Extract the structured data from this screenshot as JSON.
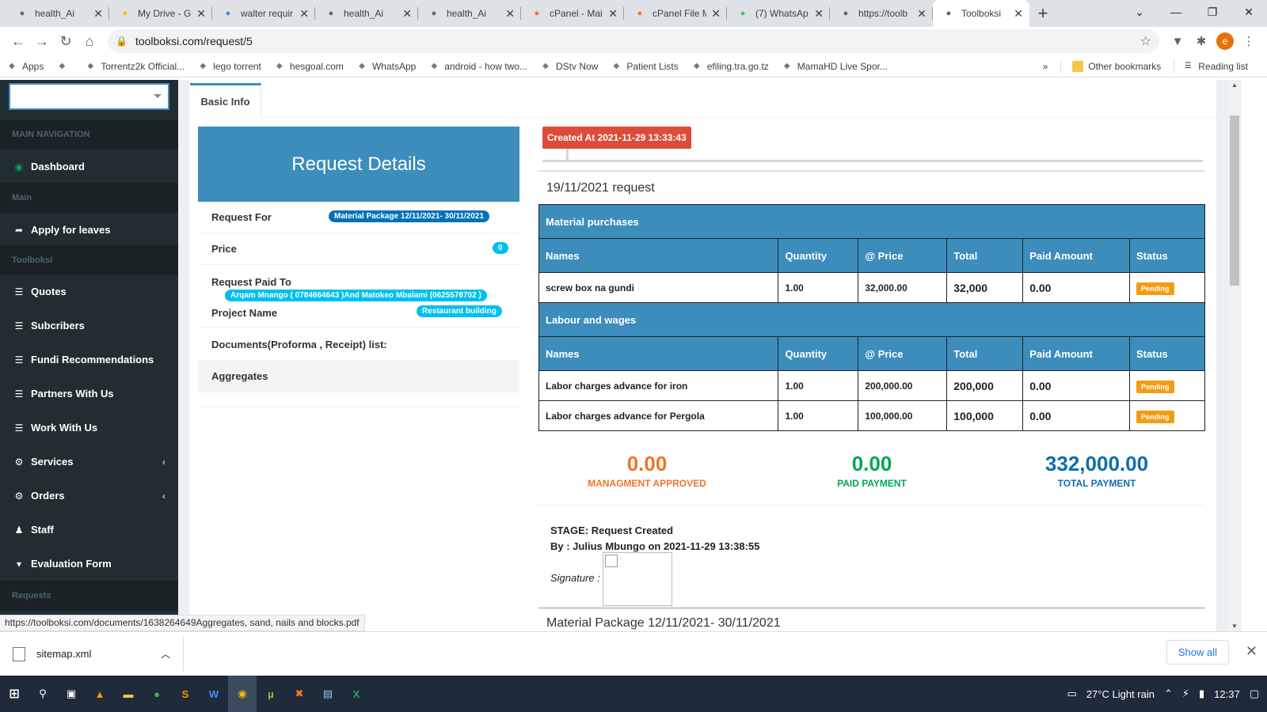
{
  "browser": {
    "tabs": [
      {
        "title": "health_Ai",
        "icon": "shield-icon",
        "color": "#5f6368"
      },
      {
        "title": "My Drive - G",
        "icon": "drive-icon",
        "color": "#fbbc04"
      },
      {
        "title": "walter requir",
        "icon": "docs-icon",
        "color": "#4285f4"
      },
      {
        "title": "health_Ai",
        "icon": "shield-icon",
        "color": "#5f6368"
      },
      {
        "title": "health_Ai",
        "icon": "shield-icon",
        "color": "#5f6368"
      },
      {
        "title": "cPanel - Mai",
        "icon": "cpanel-icon",
        "color": "#ff6c2c"
      },
      {
        "title": "cPanel File M",
        "icon": "cpanel-icon",
        "color": "#ff6c2c"
      },
      {
        "title": "(7) WhatsAp",
        "icon": "whatsapp-icon",
        "color": "#25d366"
      },
      {
        "title": "https://toolb",
        "icon": "globe-icon",
        "color": "#5f6368"
      },
      {
        "title": "Toolboksi",
        "icon": "globe-icon",
        "color": "#5f6368"
      }
    ],
    "url": "toolboksi.com/request/5",
    "bookmarks": [
      {
        "label": "Apps",
        "icon": "apps-icon"
      },
      {
        "label": "",
        "icon": "bookmark-icon"
      },
      {
        "label": "Torrentz2k Official...",
        "icon": "torrent-icon"
      },
      {
        "label": "lego torrent",
        "icon": "lego-icon"
      },
      {
        "label": "hesgoal.com",
        "icon": "hesgoal-icon"
      },
      {
        "label": "WhatsApp",
        "icon": "whatsapp-icon"
      },
      {
        "label": "android - how two...",
        "icon": "stack-icon"
      },
      {
        "label": "DStv Now",
        "icon": "play-icon"
      },
      {
        "label": "Patient Lists",
        "icon": "shield-icon"
      },
      {
        "label": "efiling.tra.go.tz",
        "icon": "tra-icon"
      },
      {
        "label": "MamaHD Live Spor...",
        "icon": "sports-icon"
      }
    ],
    "bookmarks_more": "»",
    "other_bookmarks": "Other bookmarks",
    "reading_list": "Reading list",
    "avatar_letter": "e",
    "status_url": "https://toolboksi.com/documents/1638264649Aggregates, sand, nails and blocks.pdf"
  },
  "sidebar": {
    "sections": {
      "main_navigation": "MAIN NAVIGATION",
      "main": "Main",
      "toolboksi": "Toolboksi",
      "requests": "Requests"
    },
    "items": {
      "dashboard": "Dashboard",
      "apply_leaves": "Apply for leaves",
      "quotes": "Quotes",
      "subscribers": "Subcribers",
      "fundi": "Fundi Recommendations",
      "partners": "Partners With Us",
      "work": "Work With Us",
      "services": "Services",
      "orders": "Orders",
      "staff": "Staff",
      "evaluation": "Evaluation Form"
    }
  },
  "tab_label": "Basic Info",
  "details": {
    "title": "Request Details",
    "request_for_label": "Request For",
    "request_for_value": "Material Package 12/11/2021- 30/11/2021",
    "price_label": "Price",
    "price_value": "0",
    "paid_to_label": "Request Paid To",
    "paid_to_value": "Arqam Mnango ( 0784664643 )And Matokeo Mbalami (0625578702 )",
    "project_label": "Project Name",
    "project_value": "Restaurant building",
    "documents_label": "Documents(Proforma , Receipt) list:",
    "aggregates_label": "Aggregates"
  },
  "timeline": {
    "created": "Created At 2021-11-29 13:33:43",
    "request_title": "19/11/2021 request",
    "material_section": "Material purchases",
    "labour_section": "Labour and wages",
    "columns": [
      "Names",
      "Quantity",
      "@ Price",
      "Total",
      "Paid Amount",
      "Status"
    ],
    "material_rows": [
      {
        "name": "screw box na gundi",
        "qty": "1.00",
        "price": "32,000.00",
        "total": "32,000",
        "paid": "0.00",
        "status": "Pending"
      }
    ],
    "labour_rows": [
      {
        "name": "Labor charges advance for iron",
        "qty": "1.00",
        "price": "200,000.00",
        "total": "200,000",
        "paid": "0.00",
        "status": "Pending"
      },
      {
        "name": "Labor charges advance for Pergola",
        "qty": "1.00",
        "price": "100,000.00",
        "total": "100,000",
        "paid": "0.00",
        "status": "Pending"
      }
    ],
    "stats": [
      {
        "value": "0.00",
        "label": "MANAGMENT APPROVED",
        "color": "#f0742c"
      },
      {
        "value": "0.00",
        "label": "PAID PAYMENT",
        "color": "#00a65a"
      },
      {
        "value": "332,000.00",
        "label": "TOTAL PAYMENT",
        "color": "#0f6fa8"
      }
    ],
    "stage": "STAGE: Request Created",
    "stage_by": "By : Julius Mbungo on 2021-11-29 13:38:55",
    "signature_label": "Signature :",
    "package_title": "Material Package 12/11/2021- 30/11/2021"
  },
  "downloads": {
    "file": "sitemap.xml",
    "show_all": "Show all"
  },
  "taskbar": {
    "weather": "27°C  Light rain",
    "time": "12:37"
  },
  "colors": {
    "primary": "#3c8dbc",
    "sidebar": "#222d32",
    "danger": "#dd4b39",
    "warning": "#f39c12",
    "success": "#00a65a"
  }
}
